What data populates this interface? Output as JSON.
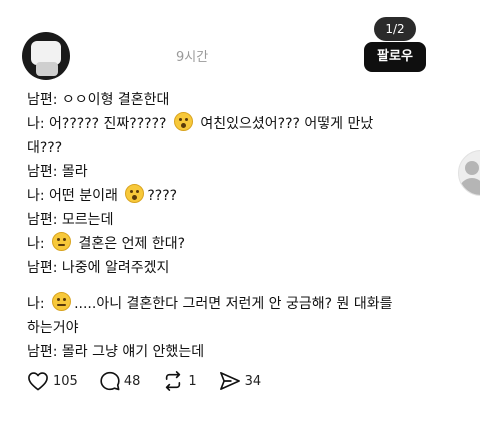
{
  "post": {
    "timestamp": "9시간",
    "page_counter": "1/2",
    "follow_label": "팔로우",
    "lines": {
      "l1": "남편: ㅇㅇ이형 결혼한대",
      "l2a": "나: 어????? 진짜?????",
      "l2b": "여친있으셨어??? 어떻게 만났",
      "l2c": "대???",
      "l3": "남편: 몰라",
      "l4a": "나: 어떤 분이래",
      "l4b": "????",
      "l5": "남편: 모르는데",
      "l6a": "나:",
      "l6b": "결혼은 언제 한대?",
      "l7": "남편: 나중에 알려주겠지",
      "l8a": "나:",
      "l8b": ".....아니 결혼한다 그러면 저런게 안 궁금해? 뭔 대화를",
      "l8c": "하는거야",
      "l9": "남편: 몰라 그냥 얘기 안했는데"
    },
    "emojis": [
      "astonished-face",
      "hushed-face",
      "neutral-face",
      "expressionless-face"
    ],
    "actions": {
      "likes": "105",
      "comments": "48",
      "reposts": "1",
      "shares": "34"
    }
  }
}
